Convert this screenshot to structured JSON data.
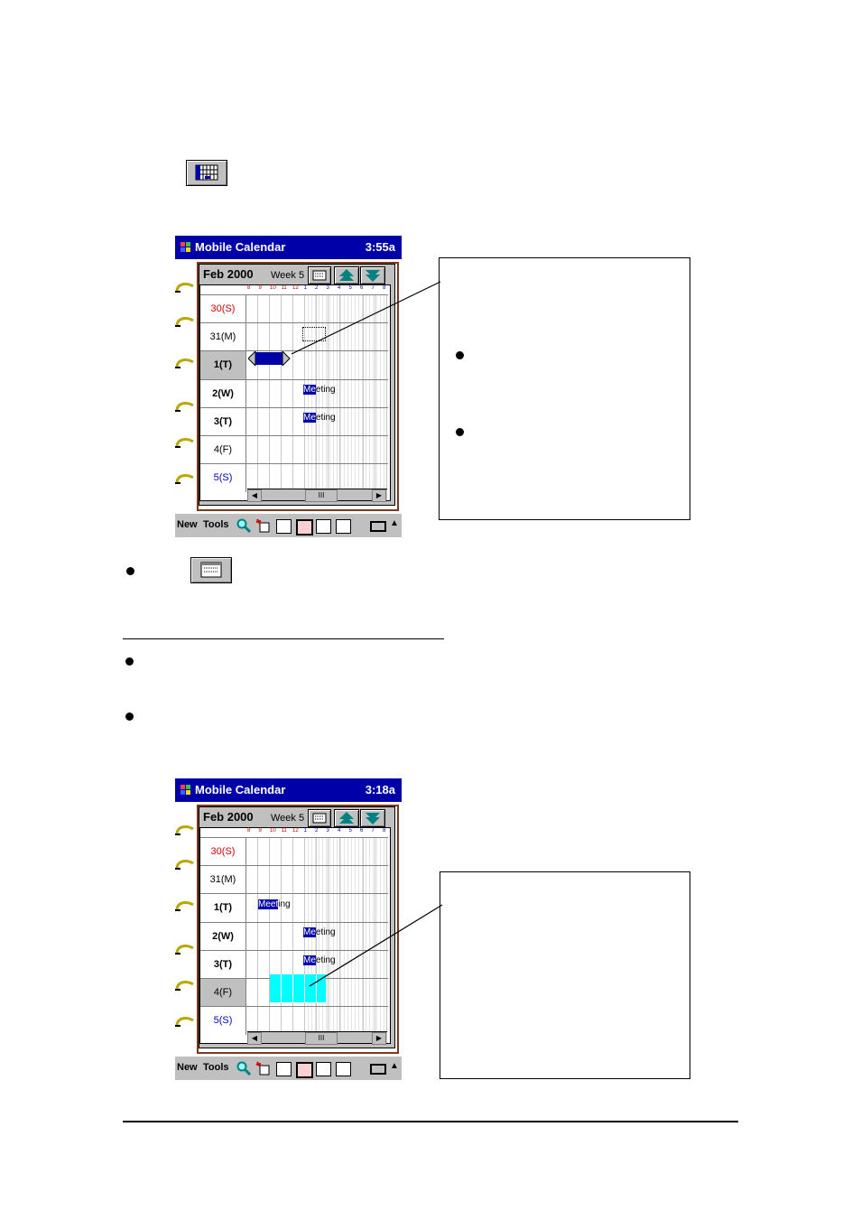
{
  "screen1": {
    "app_title": "Mobile Calendar",
    "clock": "3:55a",
    "month": "Feb 2000",
    "week": "Week 5",
    "hours": [
      "8",
      "9",
      "10",
      "11",
      "12",
      "1",
      "2",
      "3",
      "4",
      "5",
      "6",
      "7",
      "8"
    ],
    "days": [
      {
        "label": "30(S)",
        "color": "#d00000",
        "bold": false
      },
      {
        "label": "31(M)",
        "color": "#000000",
        "bold": false
      },
      {
        "label": "1(T)",
        "color": "#000000",
        "bold": true
      },
      {
        "label": "2(W)",
        "color": "#000000",
        "bold": true
      },
      {
        "label": "3(T)",
        "color": "#000000",
        "bold": true
      },
      {
        "label": "4(F)",
        "color": "#000000",
        "bold": false
      },
      {
        "label": "5(S)",
        "color": "#0000c0",
        "bold": false
      }
    ],
    "meeting_label_prefix": "Me",
    "meeting_label_suffix": "eting",
    "menu_new": "New",
    "menu_tools": "Tools"
  },
  "screen2": {
    "app_title": "Mobile Calendar",
    "clock": "3:18a",
    "month": "Feb 2000",
    "week": "Week 5",
    "meeting1_prefix": "Meet",
    "meeting1_suffix": "ing",
    "meeting_label_prefix": "Me",
    "meeting_label_suffix": "eting",
    "menu_new": "New",
    "menu_tools": "Tools"
  },
  "scrollbar_glyph": "III",
  "colors": {
    "titlebar": "#0000a8",
    "selection": "#00ffff",
    "meeting": "#0000a8",
    "binder": "#7a3a1c"
  }
}
